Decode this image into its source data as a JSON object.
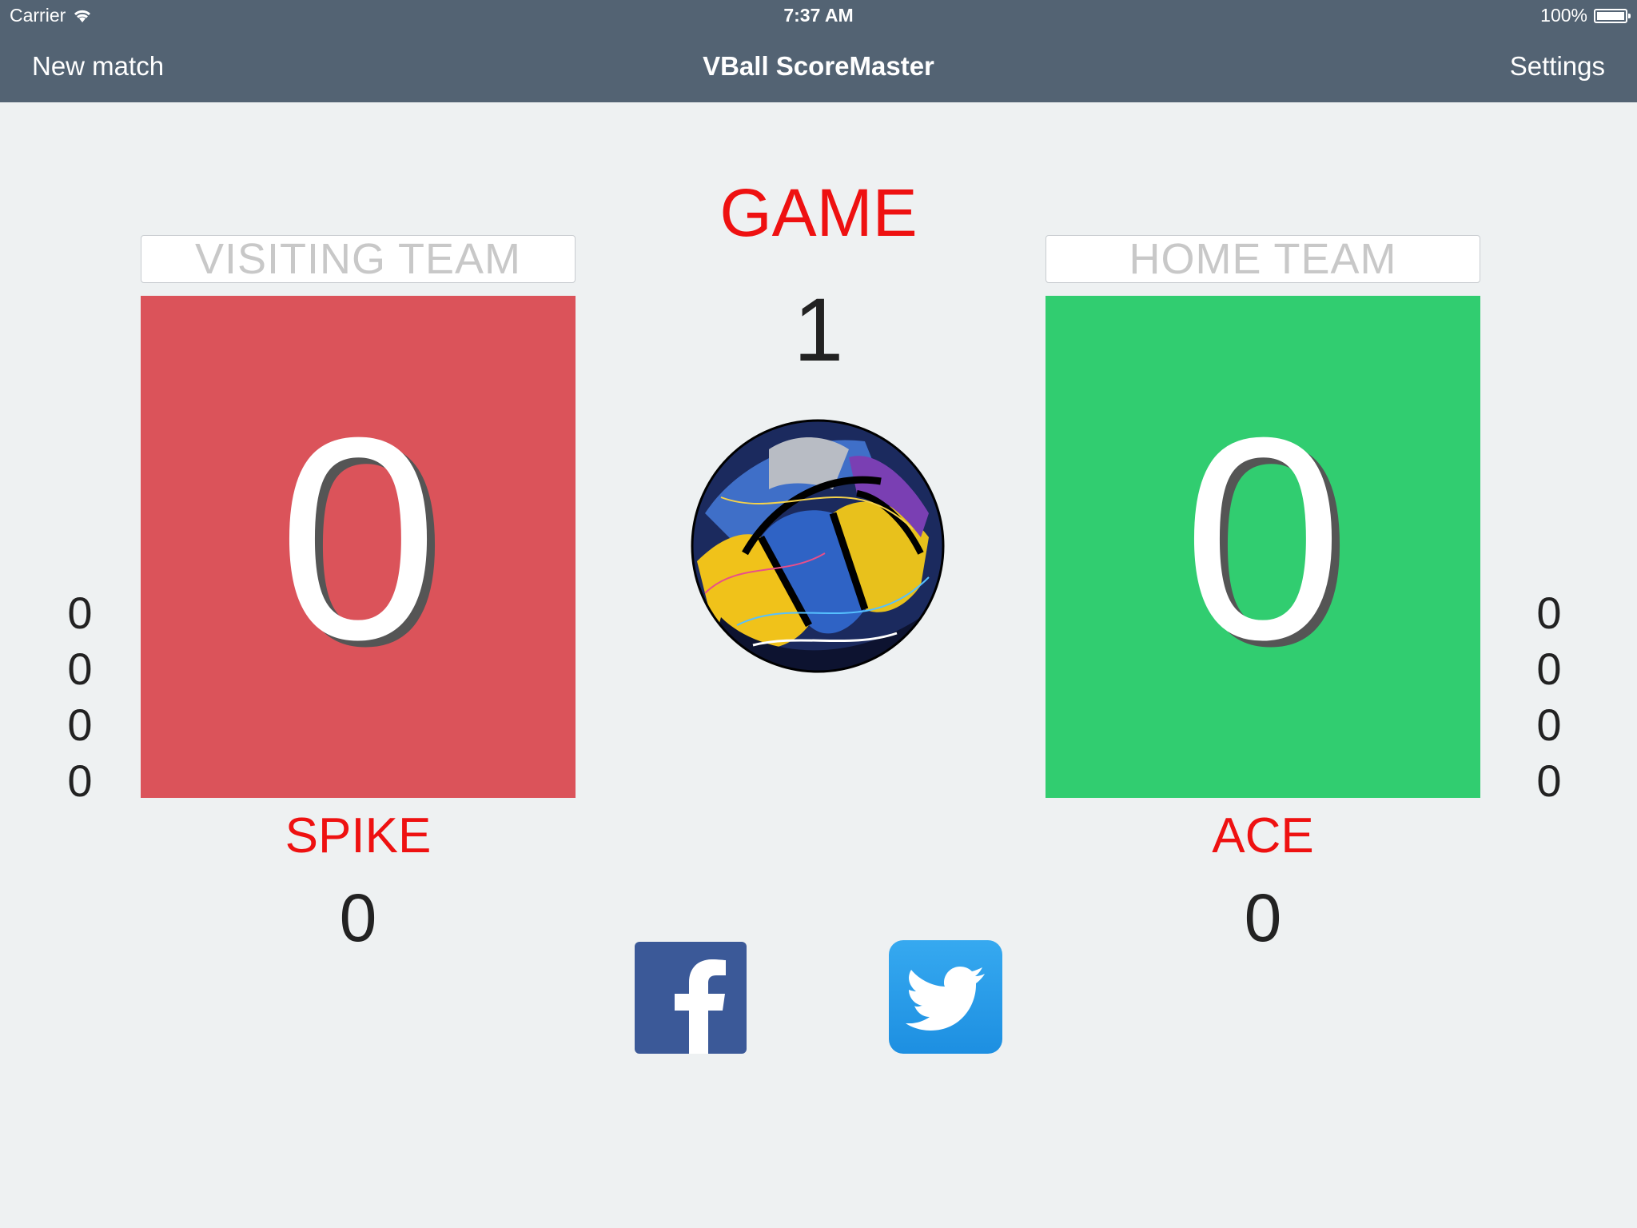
{
  "status": {
    "carrier": "Carrier",
    "time": "7:37 AM",
    "battery": "100%"
  },
  "nav": {
    "left_label": "New match",
    "title": "VBall ScoreMaster",
    "right_label": "Settings"
  },
  "game": {
    "label": "GAME",
    "number": "1"
  },
  "visitor": {
    "name_placeholder": "VISITING TEAM",
    "score": "0",
    "set_scores": [
      "0",
      "0",
      "0",
      "0"
    ],
    "stat_label": "SPIKE",
    "stat_value": "0",
    "color": "#db535a"
  },
  "home": {
    "name_placeholder": "HOME TEAM",
    "score": "0",
    "set_scores": [
      "0",
      "0",
      "0",
      "0"
    ],
    "stat_label": "ACE",
    "stat_value": "0",
    "color": "#31cd70"
  },
  "share": {
    "facebook_icon": "facebook-icon",
    "twitter_icon": "twitter-icon"
  },
  "colors": {
    "navbar": "#536373",
    "background": "#eef1f2",
    "accent_red": "#ee1111"
  }
}
